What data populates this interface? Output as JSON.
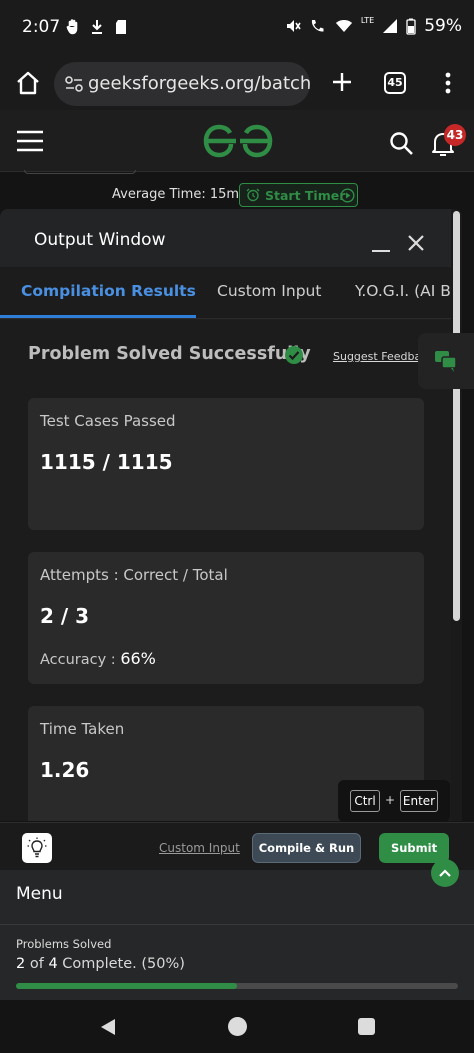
{
  "status_bar": {
    "time": "2:07",
    "network": "LTE",
    "battery": "59%"
  },
  "browser": {
    "url": "geeksforgeeks.org/batch/g",
    "tab_count": "45"
  },
  "header": {
    "notification_count": "43"
  },
  "timer": {
    "average_time": "Average Time: 15m",
    "start_label": "Start Timer"
  },
  "output_window": {
    "title": "Output Window",
    "tabs": [
      "Compilation Results",
      "Custom Input",
      "Y.O.G.I. (AI Bot)"
    ],
    "status": "Problem Solved Successfully",
    "suggest_link": "Suggest Feedback",
    "cards": {
      "test_cases": {
        "label": "Test Cases Passed",
        "value": "1115 / 1115"
      },
      "attempts": {
        "label": "Attempts : Correct / Total",
        "value": "2 / 3",
        "accuracy_label": "Accuracy :",
        "accuracy_value": "66%"
      },
      "time_taken": {
        "label": "Time Taken",
        "value": "1.26"
      }
    },
    "shortcut": {
      "key1": "Ctrl",
      "plus": "+",
      "key2": "Enter"
    }
  },
  "actions": {
    "custom_input": "Custom Input",
    "compile_run": "Compile & Run",
    "submit": "Submit"
  },
  "menu": {
    "title": "Menu",
    "problems_label": "Problems Solved",
    "solved": "2",
    "of_text": "of",
    "total": "4",
    "complete_text": "Complete. (50%)",
    "progress_fraction": 0.5
  },
  "colors": {
    "brand_green": "#2f8d46",
    "active_tab_blue": "#4a90e2",
    "badge_red": "#c62828"
  },
  "icons": [
    "home-icon",
    "tune-icon",
    "plus-icon",
    "more-vert-icon",
    "hamburger-icon",
    "gfg-logo",
    "search-icon",
    "bell-icon",
    "alarm-icon",
    "play-circle-icon",
    "minimize-icon",
    "close-icon",
    "check-circle-icon",
    "chat-icon",
    "bulb-icon",
    "chevron-up-icon",
    "back-icon",
    "home-circle-icon",
    "recents-icon"
  ]
}
